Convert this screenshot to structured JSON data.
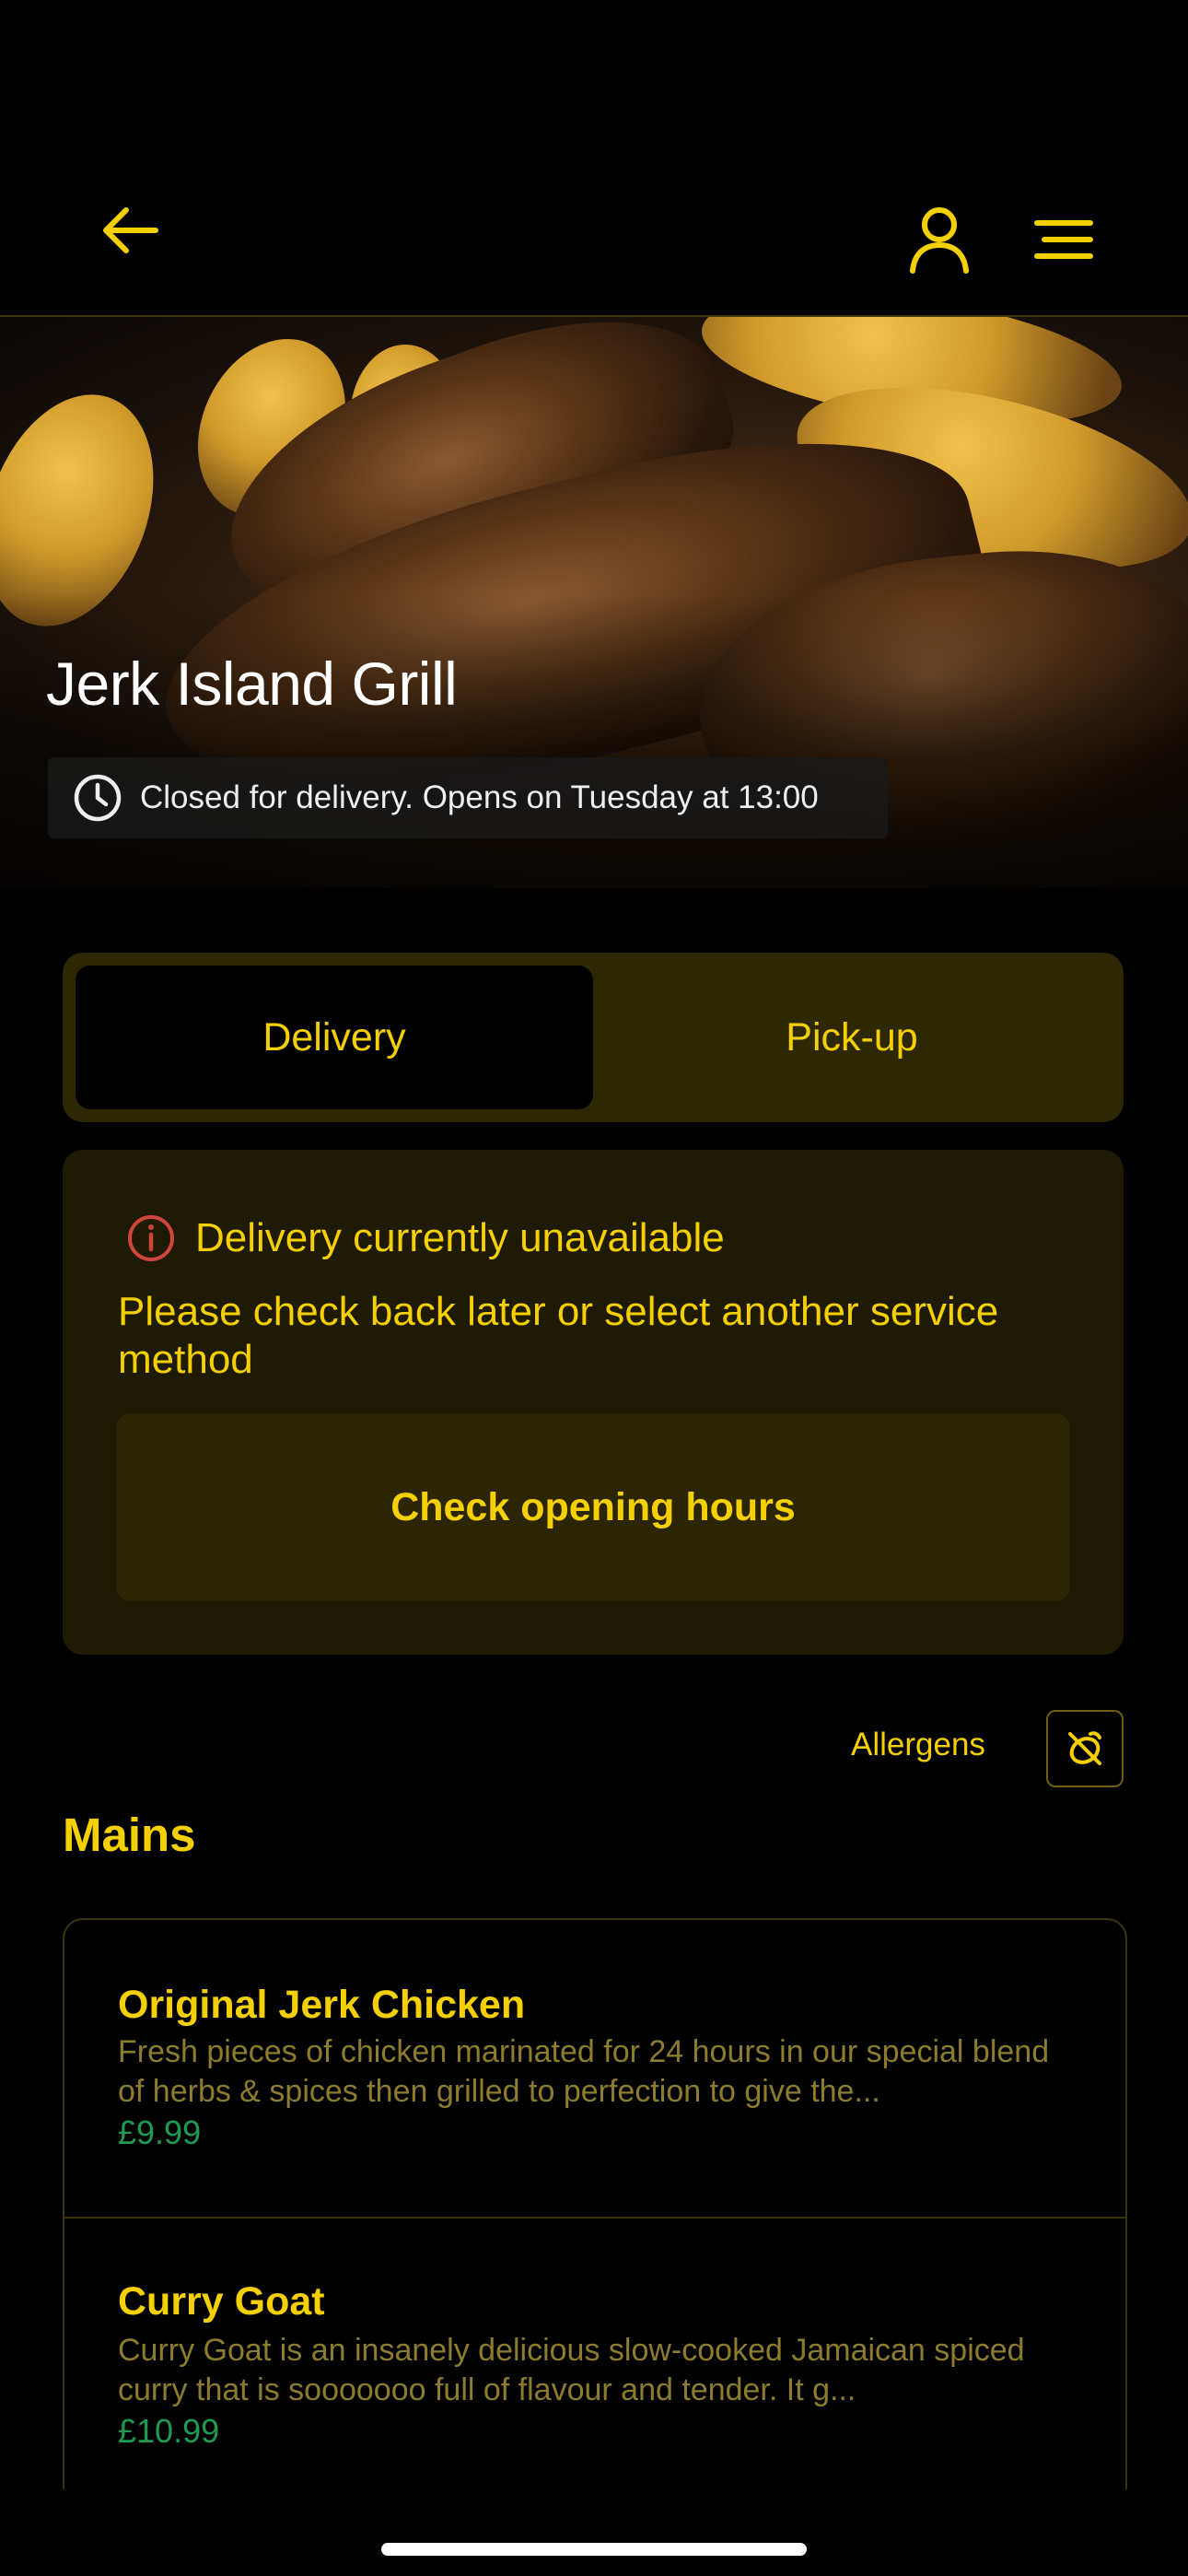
{
  "header": {
    "back_icon": "arrow-left-icon",
    "profile_icon": "user-icon",
    "menu_icon": "menu-icon",
    "accent_color": "#f5d000"
  },
  "hero": {
    "restaurant_name": "Jerk Island Grill",
    "status_icon": "clock-icon",
    "status_text": "Closed for delivery. Opens on Tuesday at 13:00"
  },
  "service_toggle": {
    "options": [
      {
        "label": "Delivery",
        "selected": true
      },
      {
        "label": "Pick-up",
        "selected": false
      }
    ]
  },
  "notice": {
    "icon": "info-icon",
    "title": "Delivery currently unavailable",
    "message": "Please check back later or select another service method",
    "button_label": "Check opening hours"
  },
  "allergens": {
    "label": "Allergens",
    "icon": "no-allergen-icon"
  },
  "menu": {
    "section_title": "Mains",
    "items": [
      {
        "name": "Original Jerk Chicken",
        "description": "Fresh pieces of chicken marinated for 24 hours in our special blend of herbs & spices then grilled to perfection to give the...",
        "price": "£9.99"
      },
      {
        "name": "Curry Goat",
        "description": "Curry Goat is an insanely delicious slow-cooked Jamaican spiced curry that is sooooooo full of flavour and tender. It g...",
        "price": "£10.99"
      }
    ]
  }
}
